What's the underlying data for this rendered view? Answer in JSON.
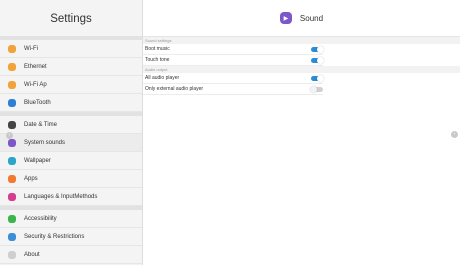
{
  "sidebar": {
    "title": "Settings",
    "groups": [
      [
        {
          "label": "Wi-Fi",
          "icon": "wifi-icon",
          "color": "#f2a23a"
        },
        {
          "label": "Ethernet",
          "icon": "ethernet-icon",
          "color": "#f2a23a"
        },
        {
          "label": "Wi-Fi Ap",
          "icon": "hotspot-icon",
          "color": "#f2a23a"
        },
        {
          "label": "BlueTooth",
          "icon": "bluetooth-icon",
          "color": "#2d7fd6"
        }
      ],
      [
        {
          "label": "Date & Time",
          "icon": "clock-icon",
          "color": "#444444"
        },
        {
          "label": "System sounds",
          "icon": "sound-icon",
          "color": "#7b57c9"
        },
        {
          "label": "Wallpaper",
          "icon": "wallpaper-icon",
          "color": "#2aa6c9"
        },
        {
          "label": "Apps",
          "icon": "apps-icon",
          "color": "#f07a2e"
        },
        {
          "label": "Languages & InputMethods",
          "icon": "language-icon",
          "color": "#d63d8c"
        }
      ],
      [
        {
          "label": "Accessibility",
          "icon": "accessibility-icon",
          "color": "#3ab54a"
        },
        {
          "label": "Security & Restrictions",
          "icon": "lock-icon",
          "color": "#3a8fd6"
        },
        {
          "label": "About",
          "icon": "info-icon",
          "color": "#cfcfcf"
        }
      ]
    ]
  },
  "main": {
    "title": "Sound",
    "header_icon": "speaker-icon",
    "header_icon_color": "#7b57c9",
    "sections": [
      {
        "label": "Sound settings",
        "rows": [
          {
            "label": "Boot music",
            "on": true
          },
          {
            "label": "Touch tone",
            "on": true
          }
        ]
      },
      {
        "label": "Audio output",
        "rows": [
          {
            "label": "All audio player",
            "on": true
          },
          {
            "label": "Only external audio player",
            "on": false
          }
        ]
      }
    ]
  },
  "colors": {
    "accent": "#2a8bd6",
    "toggle_off": "#d0d0d0"
  }
}
